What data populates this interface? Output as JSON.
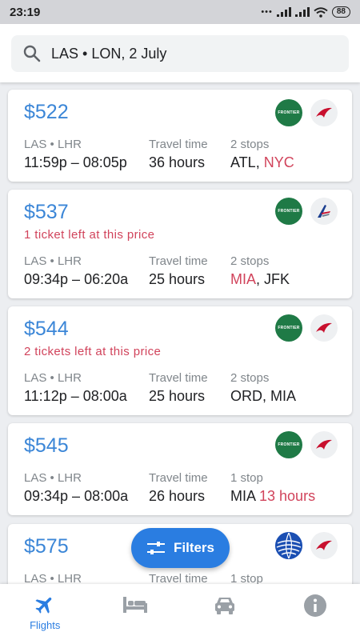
{
  "status_bar": {
    "time": "23:19",
    "battery": "88"
  },
  "search": {
    "query": "LAS • LON, 2 July"
  },
  "labels": {
    "travel_time": "Travel time"
  },
  "flights": [
    {
      "price": "$522",
      "alert": "",
      "route": "LAS • LHR",
      "times": "11:59p – 08:05p",
      "duration": "36 hours",
      "stops": "2 stops",
      "stops_detail": [
        {
          "text": "ATL",
          "red": false
        },
        {
          "text": ", ",
          "red": false
        },
        {
          "text": "NYC",
          "red": true
        }
      ],
      "airlines": [
        "frontier-logo",
        "virgin-logo"
      ]
    },
    {
      "price": "$537",
      "alert": "1 ticket left at this price",
      "route": "LAS • LHR",
      "times": "09:34p – 06:20a",
      "duration": "25 hours",
      "stops": "2 stops",
      "stops_detail": [
        {
          "text": "MIA",
          "red": true
        },
        {
          "text": ", JFK",
          "red": false
        }
      ],
      "airlines": [
        "frontier-logo",
        "american-logo"
      ]
    },
    {
      "price": "$544",
      "alert": "2 tickets left at this price",
      "route": "LAS • LHR",
      "times": "11:12p – 08:00a",
      "duration": "25 hours",
      "stops": "2 stops",
      "stops_detail": [
        {
          "text": "ORD, MIA",
          "red": false
        }
      ],
      "airlines": [
        "frontier-logo",
        "virgin-logo"
      ]
    },
    {
      "price": "$545",
      "alert": "",
      "route": "LAS • LHR",
      "times": "09:34p – 08:00a",
      "duration": "26 hours",
      "stops": "1 stop",
      "stops_detail": [
        {
          "text": "MIA ",
          "red": false
        },
        {
          "text": "13 hours",
          "red": true
        }
      ],
      "airlines": [
        "frontier-logo",
        "virgin-logo"
      ]
    },
    {
      "price": "$575",
      "alert": "",
      "route": "LAS • LHR",
      "times": "",
      "duration": "",
      "stops": "1 stop",
      "stops_detail": [],
      "airlines": [
        "united-logo",
        "virgin-logo"
      ]
    }
  ],
  "frontier_text": "FRONTIER",
  "filters": {
    "label": "Filters"
  },
  "nav": {
    "flights_label": "Flights"
  },
  "colors": {
    "accent": "#2a7de1",
    "price": "#3b86d7",
    "alert": "#d1435b",
    "frontier": "#1f7a46",
    "virgin": "#c8102e"
  }
}
